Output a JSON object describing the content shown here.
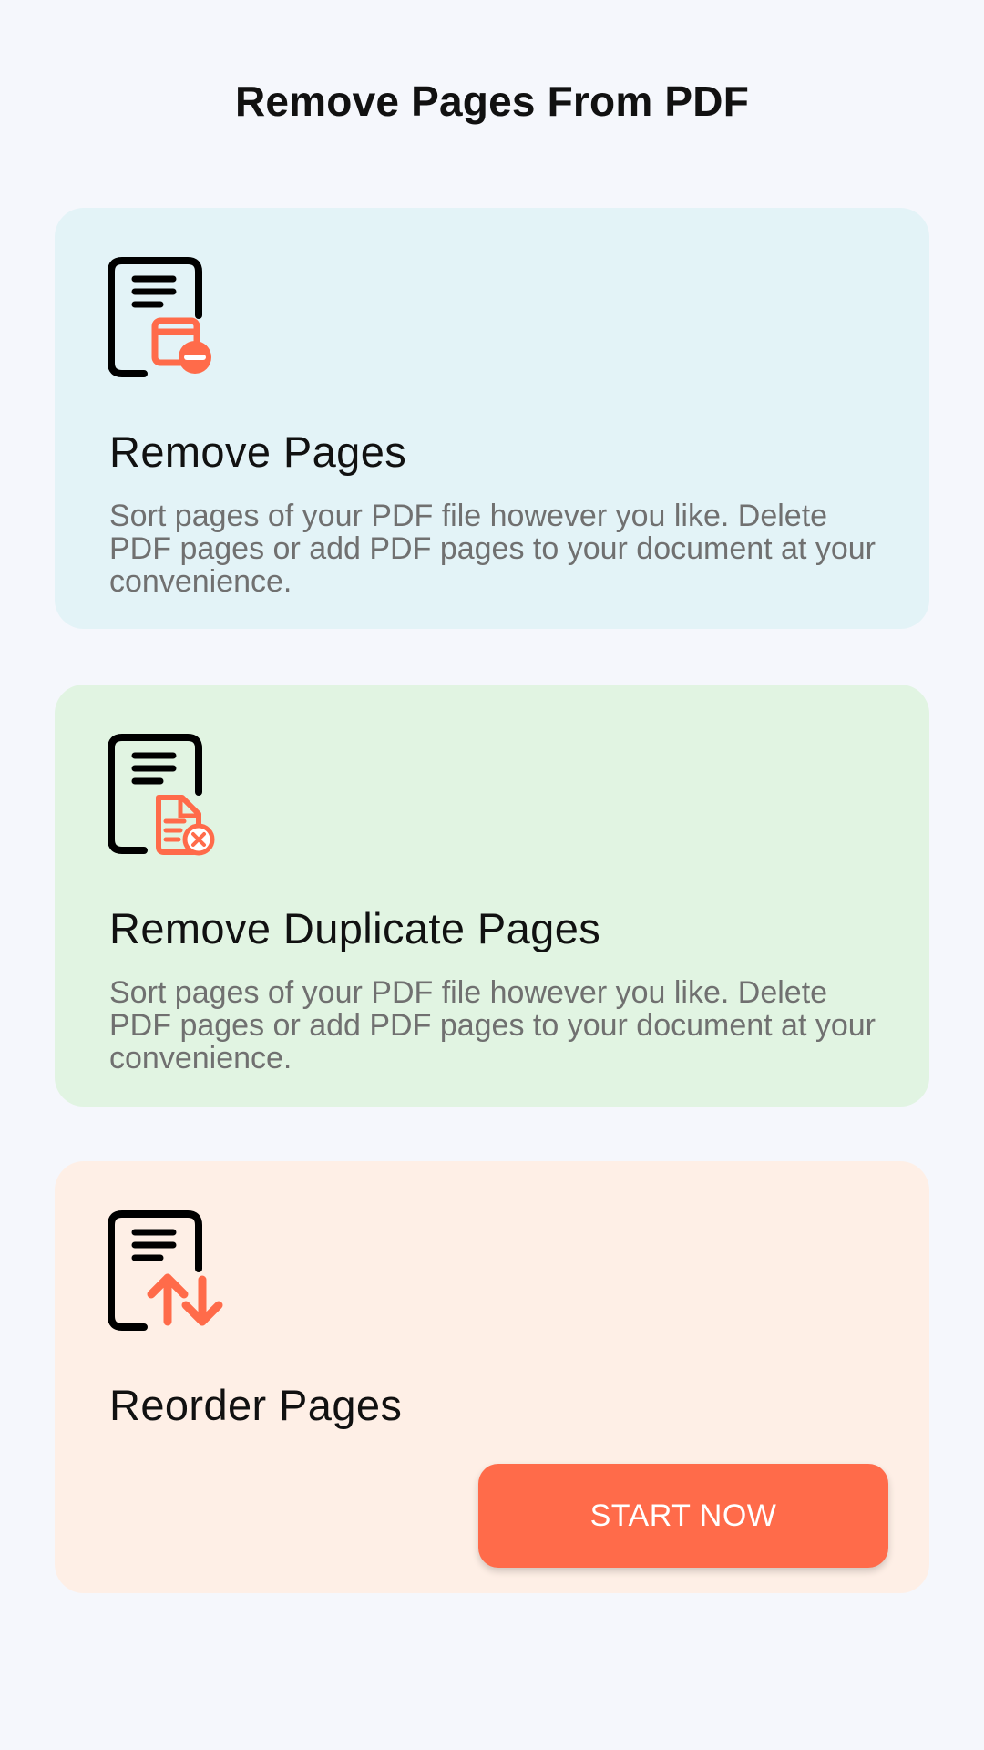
{
  "header": {
    "title": "Remove Pages From PDF"
  },
  "colors": {
    "page_background": "#F5F7FC",
    "icon_accent": "#FF6B4A",
    "icon_outline": "#000000",
    "button_background": "#FF6B4A",
    "button_text": "#FFFFFF"
  },
  "cards": [
    {
      "title": "Remove Pages",
      "description": "Sort pages of your PDF file however you like. Delete PDF pages or add PDF pages to your document at your convenience.",
      "background": "#E3F3F7",
      "icon": "document-remove-page-icon"
    },
    {
      "title": "Remove Duplicate Pages",
      "description": "Sort pages of your PDF file however you like. Delete PDF pages or add PDF pages to your document at your convenience.",
      "background": "#E1F4E2",
      "icon": "document-remove-duplicate-icon"
    },
    {
      "title": "Reorder Pages",
      "background": "#FEEFE6",
      "icon": "document-reorder-icon",
      "button_label": "START NOW"
    }
  ]
}
